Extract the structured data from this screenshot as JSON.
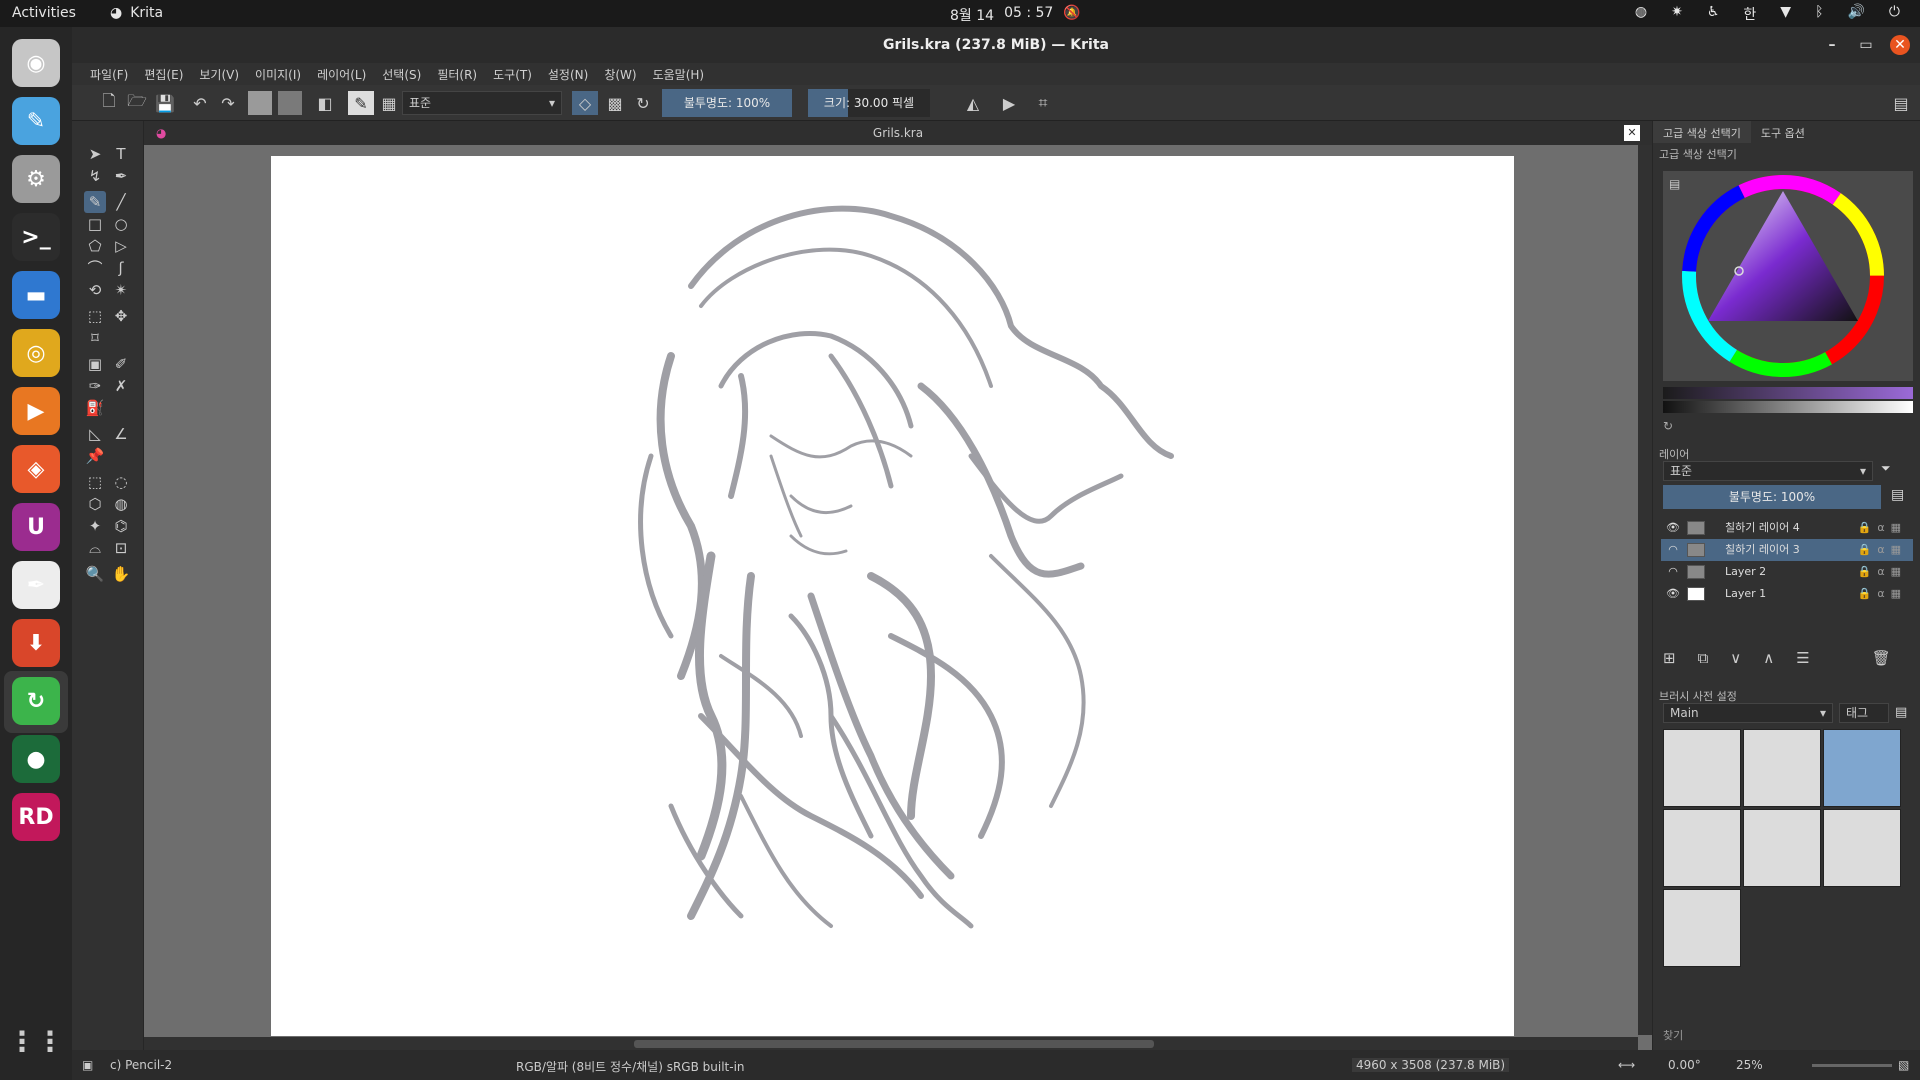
{
  "system_bar": {
    "activities": "Activities",
    "app_name": "Krita",
    "date": "8월 14",
    "time": "05 : 57",
    "input_method": "한"
  },
  "dock": {
    "apps": [
      {
        "name": "screenshot-app",
        "glyph": "◉",
        "color": "#c6c6c6"
      },
      {
        "name": "krita-launcher",
        "glyph": "✎",
        "color": "#4aa3df"
      },
      {
        "name": "settings",
        "glyph": "⚙",
        "color": "#9a9a9a"
      },
      {
        "name": "terminal",
        "glyph": ">_",
        "color": "#2c2c2c"
      },
      {
        "name": "files",
        "glyph": "▬",
        "color": "#2f78d0"
      },
      {
        "name": "chrome",
        "glyph": "◎",
        "color": "#e0a81d"
      },
      {
        "name": "media-player",
        "glyph": "▶",
        "color": "#e87722"
      },
      {
        "name": "firefox",
        "glyph": "◈",
        "color": "#e8592b"
      },
      {
        "name": "u-app",
        "glyph": "U",
        "color": "#9b2c8f"
      },
      {
        "name": "krita",
        "glyph": "✒",
        "color": "#ededed"
      },
      {
        "name": "downloader",
        "glyph": "⬇",
        "color": "#d9462a"
      },
      {
        "name": "updater",
        "glyph": "↻",
        "color": "#3cb44b"
      },
      {
        "name": "webcam",
        "glyph": "●",
        "color": "#1c6b3a"
      },
      {
        "name": "rider",
        "glyph": "RD",
        "color": "#c2185b"
      }
    ]
  },
  "window": {
    "title": "Grils.kra (237.8 MiB)  — Krita"
  },
  "menu": [
    "파일(F)",
    "편집(E)",
    "보기(V)",
    "이미지(I)",
    "레이어(L)",
    "선택(S)",
    "필터(R)",
    "도구(T)",
    "설정(N)",
    "창(W)",
    "도움말(H)"
  ],
  "toolbar": {
    "blend_mode": "표준",
    "opacity_label": "불투명도: 100%",
    "size_label": "크기: 30.00 픽셀"
  },
  "document": {
    "tab_title": "Grils.kra"
  },
  "dockers": {
    "tabs": [
      "고급 색상 선택기",
      "도구 옵션"
    ],
    "color_panel_title": "고급 색상 선택기",
    "layers_title": "레이어",
    "layers_blend": "표준",
    "layers_opacity": "불투명도:  100%",
    "layers": [
      {
        "name": "칠하기 레이어 4",
        "visible": true,
        "selected": false
      },
      {
        "name": "칠하기 레이어 3",
        "visible": false,
        "selected": true
      },
      {
        "name": "Layer 2",
        "visible": false,
        "selected": false
      },
      {
        "name": "Layer 1",
        "visible": true,
        "selected": false
      }
    ],
    "brush_title": "브러시 사전 설정",
    "brush_group": "Main",
    "brush_tag": "태그",
    "search_label": "찾기"
  },
  "status": {
    "brush": "c) Pencil-2",
    "colorspace": "RGB/알파 (8비트 정수/채널)  sRGB built-in",
    "image_size": "4960 x 3508 (237.8 MiB)",
    "rotation": "0.00°",
    "zoom": "25%"
  },
  "colors": {
    "accent": "#4a6785",
    "sketch_stroke": "#8f8f96"
  }
}
